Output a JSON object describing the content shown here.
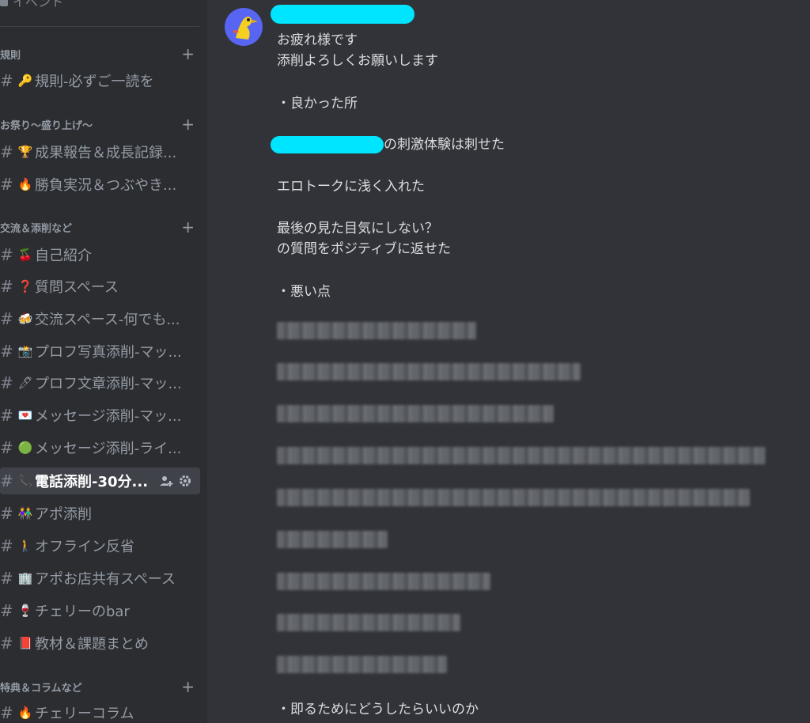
{
  "sidebar": {
    "top_partial": "イベント",
    "categories": [
      {
        "label": "規則"
      },
      {
        "label": "お祭り〜盛り上げ〜"
      },
      {
        "label": "交流＆添削など"
      },
      {
        "label": "特典＆コラムなど"
      }
    ],
    "channels": [
      {
        "emoji": "🔑",
        "name": "規則-必ずご一読を"
      },
      {
        "emoji": "🏆",
        "name": "成果報告＆成長記録..."
      },
      {
        "emoji": "🔥",
        "name": "勝負実況＆つぶやき..."
      },
      {
        "emoji": "🍒",
        "name": "自己紹介"
      },
      {
        "emoji": "❓",
        "name": "質問スペース"
      },
      {
        "emoji": "🍻",
        "name": "交流スペース-何でも..."
      },
      {
        "emoji": "📸",
        "name": "プロフ写真添削-マッ..."
      },
      {
        "emoji": "🖊",
        "name": "プロフ文章添削-マッ..."
      },
      {
        "emoji": "💌",
        "name": "メッセージ添削-マッ..."
      },
      {
        "emoji": "🟢",
        "name": "メッセージ添削-ライ..."
      },
      {
        "emoji": "📞",
        "name": "電話添削-30分..."
      },
      {
        "emoji": "👫",
        "name": "アポ添削"
      },
      {
        "emoji": "🚶",
        "name": "オフライン反省"
      },
      {
        "emoji": "🏢",
        "name": "アポお店共有スペース"
      },
      {
        "emoji": "🍷",
        "name": "チェリーのbar"
      },
      {
        "emoji": "📕",
        "name": "教材＆課題まとめ"
      },
      {
        "emoji": "🔥",
        "name": "チェリーコラム"
      }
    ],
    "hash": "#",
    "plus": "+"
  },
  "message": {
    "lines": [
      "お疲れ様です",
      "添削よろしくお願いします",
      "・良かった所",
      "の刺激体験は刺せた",
      "エロトークに浅く入れた",
      "最後の見た目気にしない？",
      "の質問をポジティブに返せた",
      "・悪い点",
      "・即るためにどうしたらいいのか"
    ]
  },
  "colors": {
    "background": "#313338",
    "sidebar": "#2b2d31",
    "redaction": "#00e5ff",
    "active_channel": "#404249"
  }
}
